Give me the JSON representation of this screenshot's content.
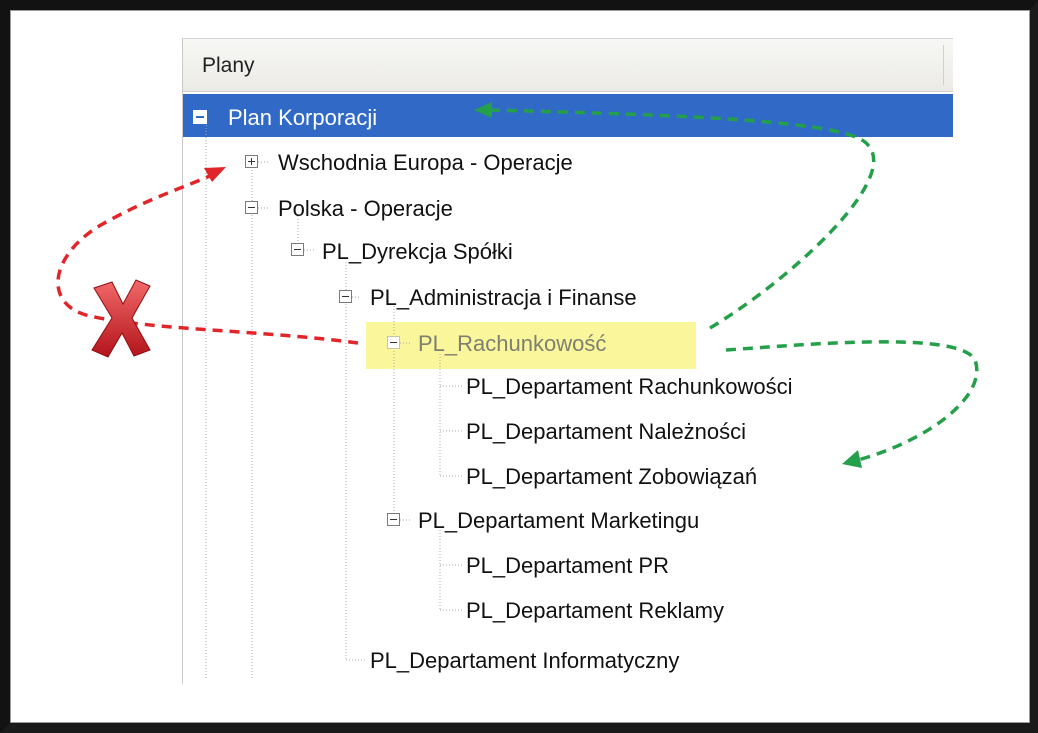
{
  "panel": {
    "header_title": "Plany"
  },
  "tree": {
    "root": "Plan Korporacji",
    "n1": "Wschodnia Europa - Operacje",
    "n2": "Polska - Operacje",
    "n3": "PL_Dyrekcja Spółki",
    "n4": "PL_Administracja  i  Finanse",
    "n5": "PL_Rachunkowość",
    "n5a": "PL_Departament Rachunkowości",
    "n5b": "PL_Departament Należności",
    "n5c": "PL_Departament Zobowiązań",
    "n6": "PL_Departament Marketingu",
    "n6a": "PL_Departament PR",
    "n6b": "PL_Departament Reklamy",
    "n7": "PL_Departament Informatyczny"
  },
  "colors": {
    "selection": "#3169c6",
    "highlight": "#f9f69b",
    "red_arrow": "#e0262b",
    "green_arrow": "#24a04a"
  },
  "icons": [
    "minus-box-icon",
    "plus-box-icon",
    "red-x-icon"
  ]
}
